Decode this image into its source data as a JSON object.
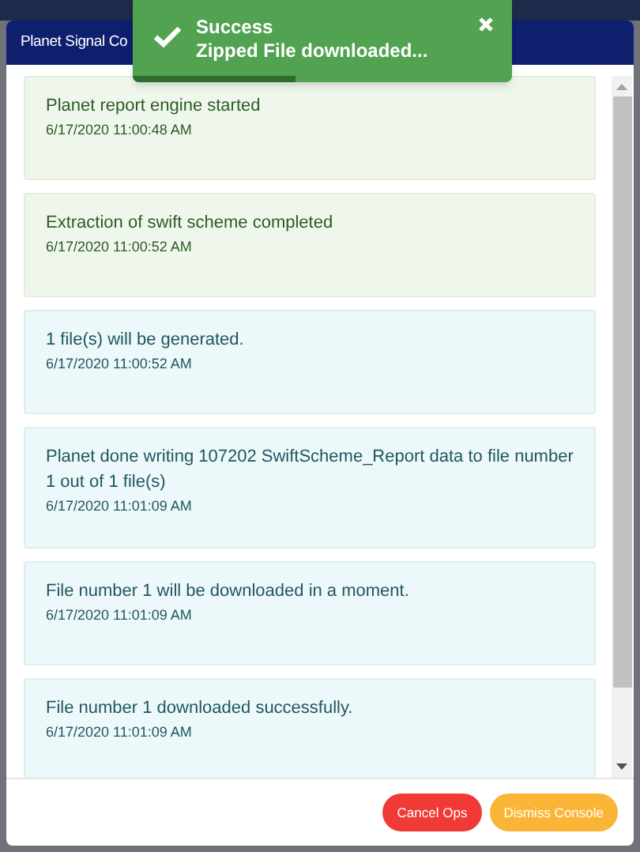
{
  "window": {
    "title": "Planet Signal Co"
  },
  "toast": {
    "title": "Success",
    "message": "Zipped File downloaded...",
    "level": 0.43
  },
  "messages": [
    {
      "kind": "success",
      "text": "Planet report engine started",
      "time": "6/17/2020 11:00:48 AM"
    },
    {
      "kind": "success",
      "text": "Extraction of swift scheme completed",
      "time": "6/17/2020 11:00:52 AM"
    },
    {
      "kind": "info",
      "text": "1 file(s) will be generated.",
      "time": "6/17/2020 11:00:52 AM"
    },
    {
      "kind": "info",
      "text": "Planet done writing 107202 SwiftScheme_Report data to file number 1 out of 1 file(s)",
      "time": "6/17/2020 11:01:09 AM"
    },
    {
      "kind": "info",
      "text": "File number 1 will be downloaded in a moment.",
      "time": "6/17/2020 11:01:09 AM"
    },
    {
      "kind": "info",
      "text": "File number 1 downloaded successfully.",
      "time": "6/17/2020 11:01:09 AM"
    }
  ],
  "buttons": [
    {
      "kind": "danger",
      "label": "Cancel Ops"
    },
    {
      "kind": "warning",
      "label": "Dismiss Console"
    }
  ]
}
